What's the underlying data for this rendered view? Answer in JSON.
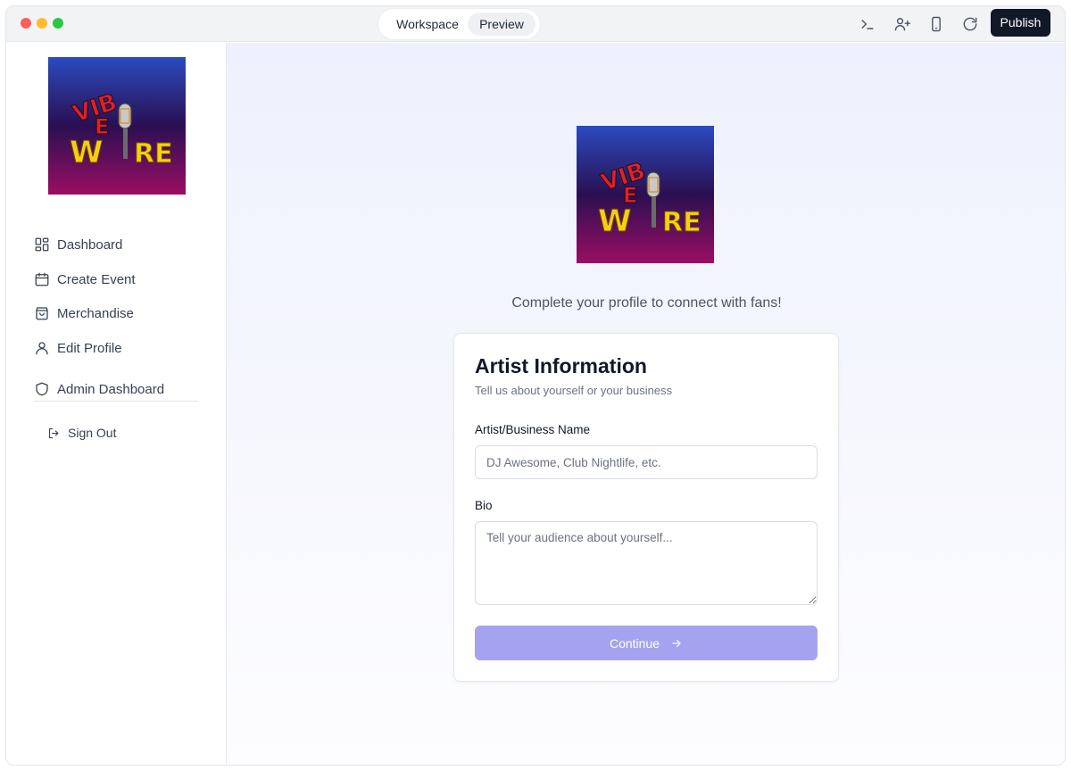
{
  "titlebar": {
    "tabs": [
      {
        "label": "Workspace",
        "active": false
      },
      {
        "label": "Preview",
        "active": true
      }
    ],
    "icons": [
      "terminal-icon",
      "add-user-icon",
      "device-icon",
      "refresh-icon"
    ],
    "publish_label": "Publish"
  },
  "brand": {
    "logo_text": "VIBE WIRE",
    "logo_colors": {
      "bg_top": "#2a4bbf",
      "bg_mid": "#2a0f52",
      "bg_bottom": "#9a0e63",
      "letters_red": "#e0202a",
      "letters_yellow": "#f6cf12"
    }
  },
  "sidebar": {
    "items": [
      {
        "label": "Dashboard",
        "icon": "grid-icon"
      },
      {
        "label": "Create Event",
        "icon": "calendar-icon"
      },
      {
        "label": "Merchandise",
        "icon": "shopping-bag-icon"
      },
      {
        "label": "Edit Profile",
        "icon": "user-icon"
      },
      {
        "label": "Admin Dashboard",
        "icon": "shield-icon"
      }
    ],
    "sign_out": "Sign Out"
  },
  "main": {
    "tagline": "Complete your profile to connect with fans!",
    "card": {
      "title": "Artist Information",
      "subtitle": "Tell us about yourself or your business",
      "name_label": "Artist/Business Name",
      "name_placeholder": "DJ Awesome, Club Nightlife, etc.",
      "name_value": "",
      "bio_label": "Bio",
      "bio_placeholder": "Tell your audience about yourself...",
      "bio_value": "",
      "continue_label": "Continue"
    }
  },
  "colors": {
    "accent": "#a5a3f0",
    "publish_bg": "#111827"
  }
}
